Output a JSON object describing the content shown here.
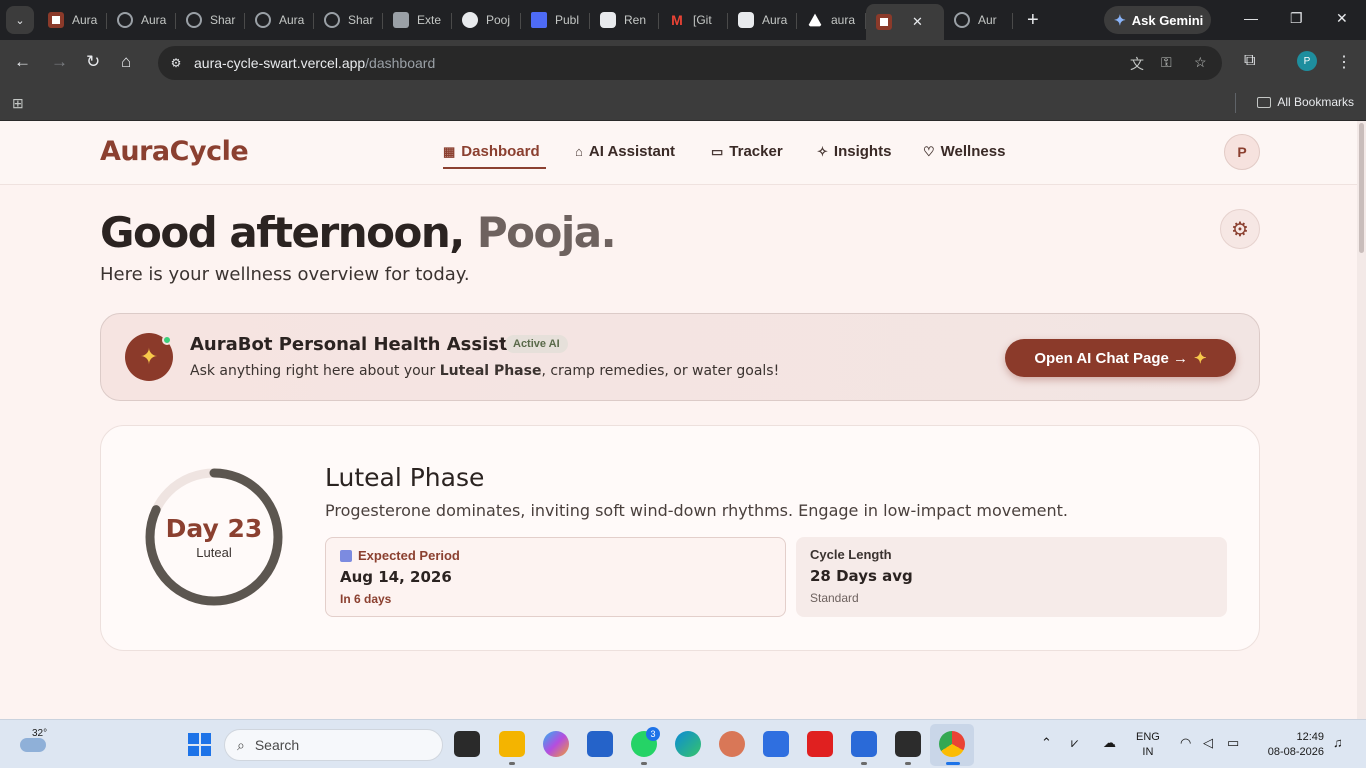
{
  "browser": {
    "tabs": [
      {
        "label": "Aura",
        "icon": "aura-favicon"
      },
      {
        "label": "Aura",
        "icon": "globe-icon"
      },
      {
        "label": "Shar",
        "icon": "globe-icon"
      },
      {
        "label": "Aura",
        "icon": "globe-icon"
      },
      {
        "label": "Shar",
        "icon": "globe-icon"
      },
      {
        "label": "Exte",
        "icon": "puzzle-icon"
      },
      {
        "label": "Pooj",
        "icon": "github-icon"
      },
      {
        "label": "Publ",
        "icon": "publish-icon"
      },
      {
        "label": "Ren",
        "icon": "render-icon"
      },
      {
        "label": "[Git",
        "icon": "gmail-icon"
      },
      {
        "label": "Aura",
        "icon": "render-check-icon"
      },
      {
        "label": "aura",
        "icon": "vercel-icon"
      },
      {
        "label": "",
        "icon": "aura-favicon",
        "active": true
      },
      {
        "label": "Aur",
        "icon": "globe-icon"
      }
    ],
    "ask_gemini": "Ask Gemini",
    "url_host": "aura-cycle-swart.vercel.app",
    "url_path": "/dashboard",
    "profile_initial": "P",
    "all_bookmarks": "All Bookmarks"
  },
  "app": {
    "brand": "AuraCycle",
    "nav": [
      {
        "label": "Dashboard",
        "icon": "grid-icon",
        "active": true
      },
      {
        "label": "AI Assistant",
        "icon": "bot-icon"
      },
      {
        "label": "Tracker",
        "icon": "calendar-icon"
      },
      {
        "label": "Insights",
        "icon": "sparkle-icon"
      },
      {
        "label": "Wellness",
        "icon": "heart-icon"
      }
    ],
    "avatar_initial": "P"
  },
  "greeting": {
    "prefix": "Good afternoon, ",
    "name": "Pooja.",
    "subtitle": "Here is your wellness overview for today."
  },
  "aurabot": {
    "title": "AuraBot Personal Health Assistant",
    "badge": "Active AI",
    "desc_prefix": "Ask anything right here about your ",
    "desc_bold": "Luteal Phase",
    "desc_suffix": ", cramp remedies, or water goals!",
    "button": "Open AI Chat Page →"
  },
  "phase": {
    "ring_day": "Day 23",
    "ring_phase": "Luteal",
    "ring_progress": 0.82,
    "title": "Luteal Phase",
    "desc": "Progesterone dominates, inviting soft wind-down rhythms. Engage in low-impact movement.",
    "expected_period": {
      "label": "Expected Period",
      "value": "Aug 14, 2026",
      "sub": "In 6 days"
    },
    "cycle_length": {
      "label": "Cycle Length",
      "value": "28 Days avg",
      "sub": "Standard"
    }
  },
  "taskbar": {
    "temperature": "32°",
    "search_placeholder": "Search",
    "whatsapp_badge": "3",
    "lang_top": "ENG",
    "lang_bottom": "IN",
    "time": "12:49",
    "date": "08-08-2026"
  },
  "colors": {
    "brand": "#8b4030",
    "accent_button": "#8b3a2a",
    "page_bg": "#fdf3f1"
  }
}
